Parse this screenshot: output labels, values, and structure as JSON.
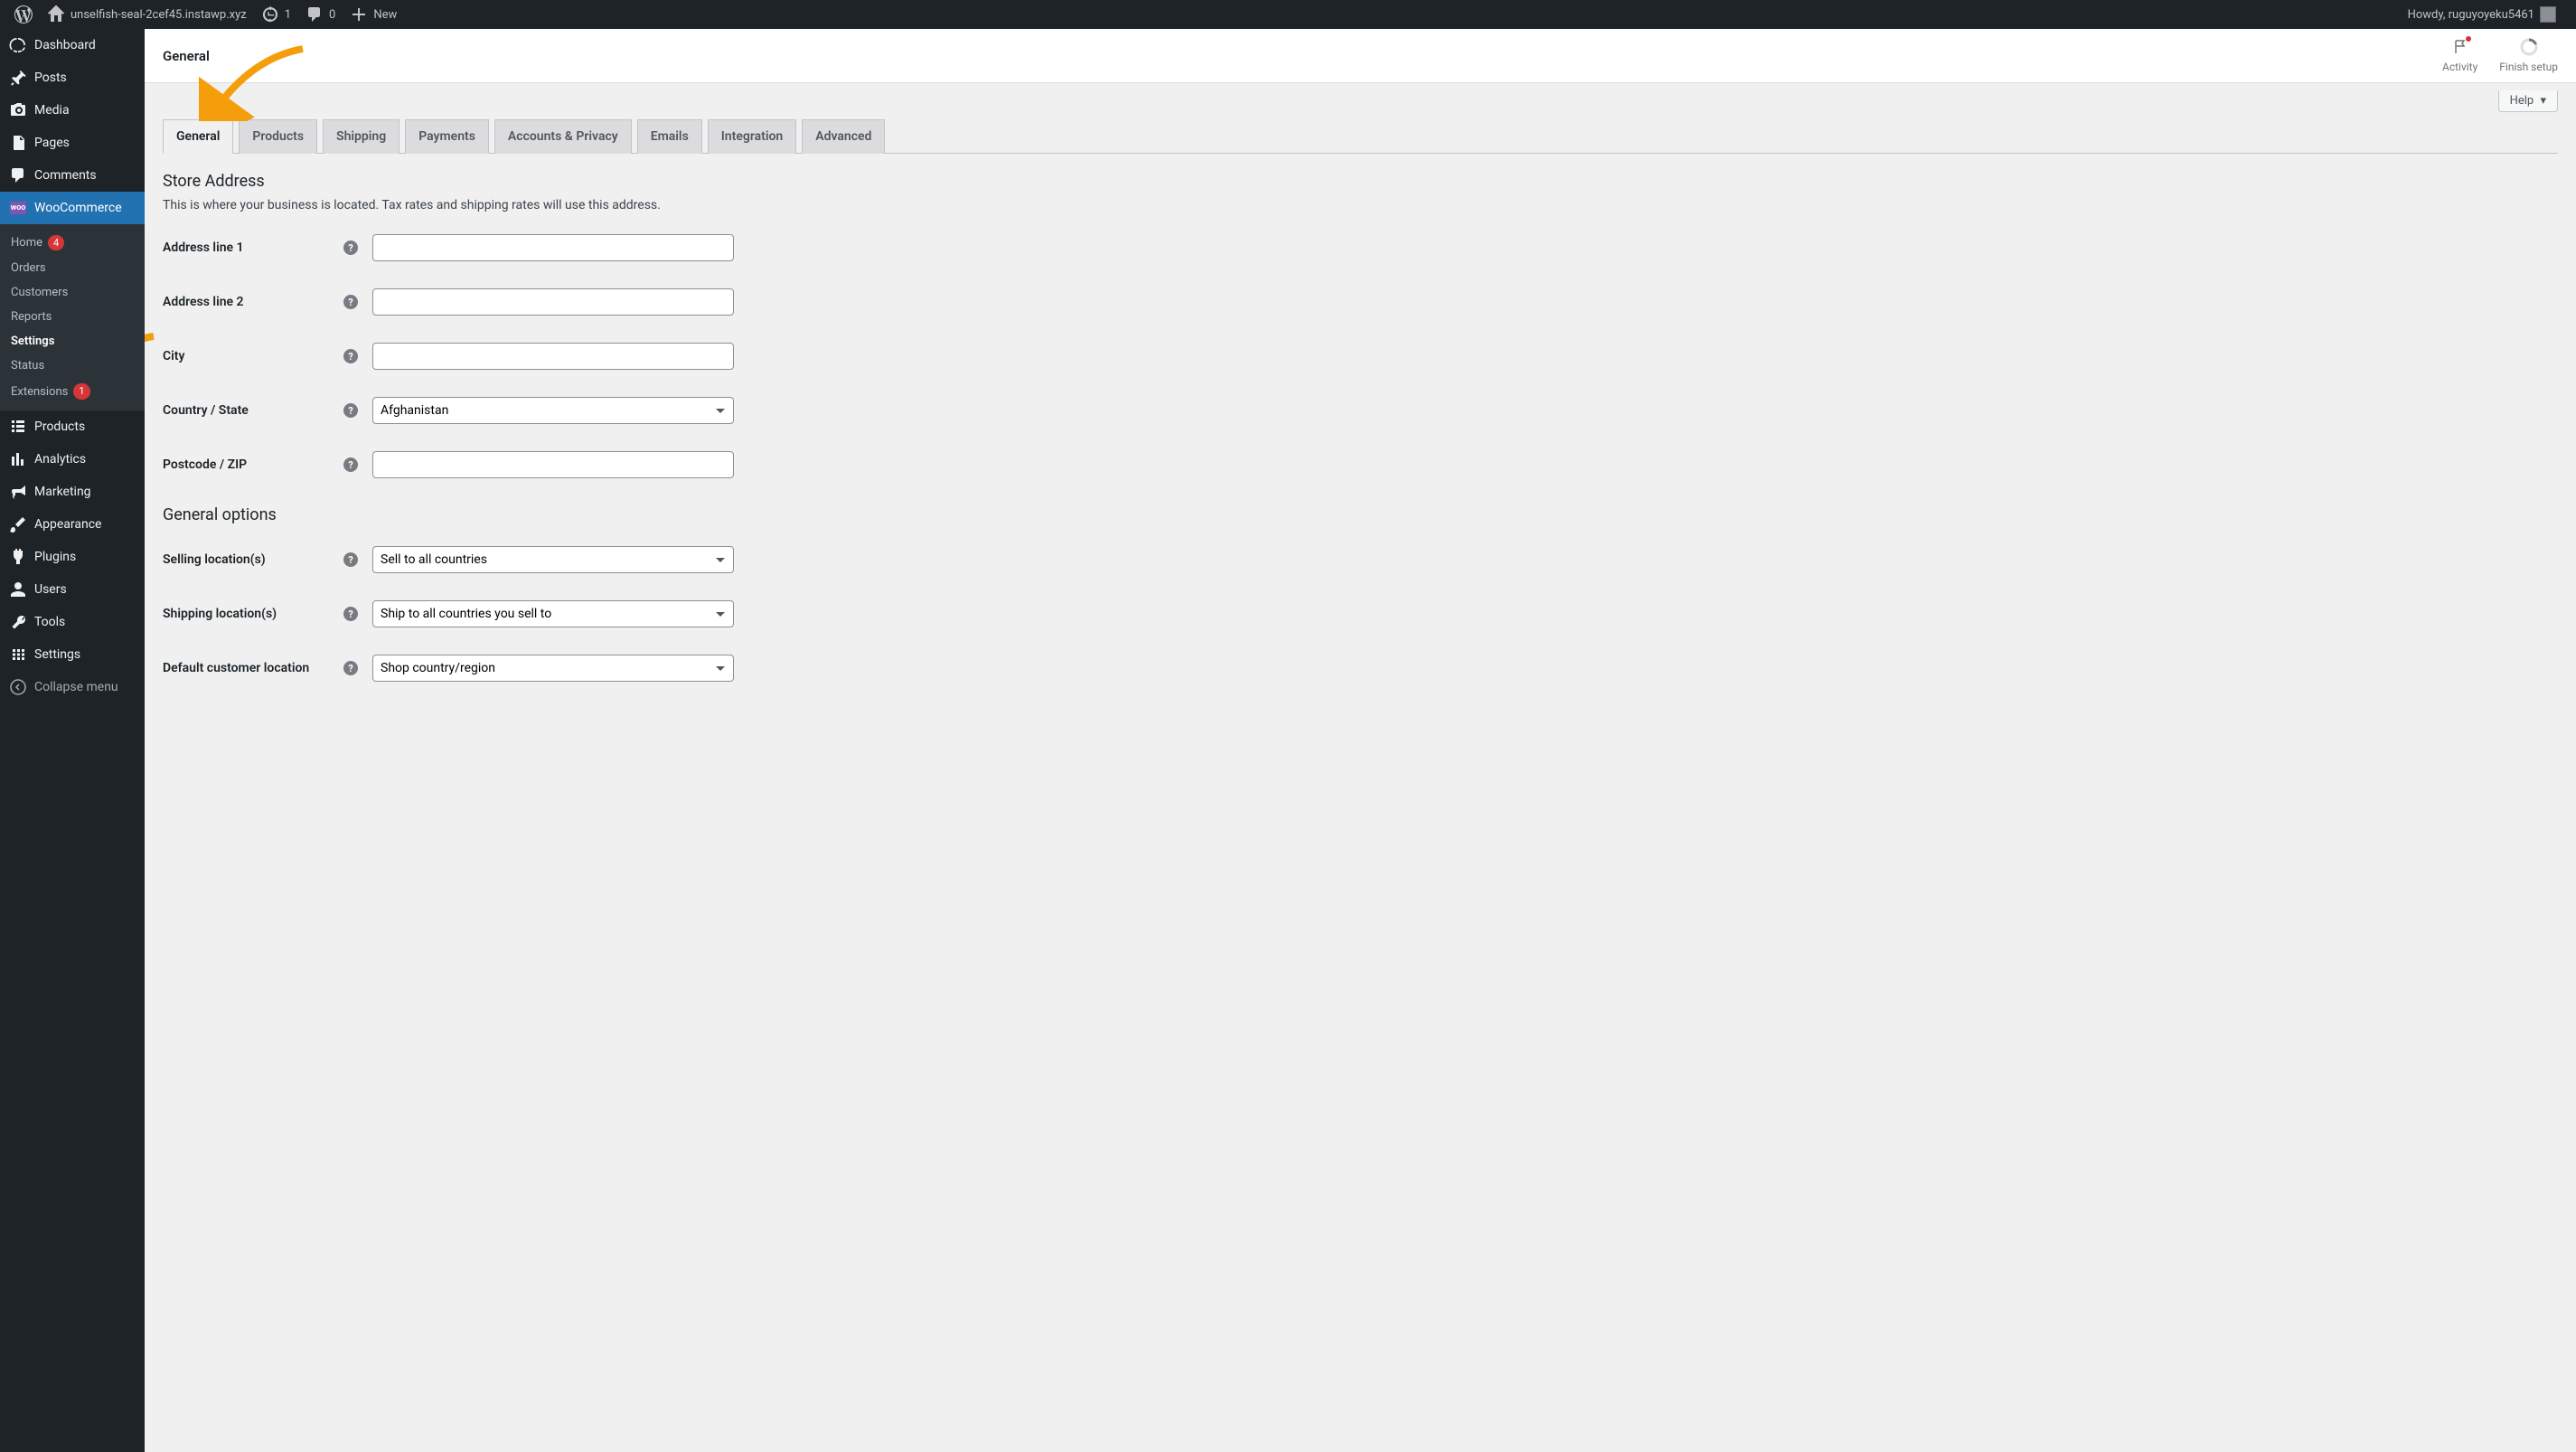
{
  "adminBar": {
    "siteName": "unselfish-seal-2cef45.instawp.xyz",
    "updateCount": "1",
    "commentCount": "0",
    "newLabel": "New",
    "howdy": "Howdy, ruguyoyeku5461"
  },
  "sidebar": {
    "dashboard": "Dashboard",
    "posts": "Posts",
    "media": "Media",
    "pages": "Pages",
    "comments": "Comments",
    "woocommerce": "WooCommerce",
    "wooSubmenu": {
      "home": "Home",
      "homeBadge": "4",
      "orders": "Orders",
      "customers": "Customers",
      "reports": "Reports",
      "settings": "Settings",
      "status": "Status",
      "extensions": "Extensions",
      "extensionsBadge": "1"
    },
    "products": "Products",
    "analytics": "Analytics",
    "marketing": "Marketing",
    "appearance": "Appearance",
    "plugins": "Plugins",
    "users": "Users",
    "tools": "Tools",
    "settingsMain": "Settings",
    "collapse": "Collapse menu"
  },
  "header": {
    "title": "General",
    "activity": "Activity",
    "finishSetup": "Finish setup",
    "help": "Help"
  },
  "tabs": {
    "general": "General",
    "products": "Products",
    "shipping": "Shipping",
    "payments": "Payments",
    "accounts": "Accounts & Privacy",
    "emails": "Emails",
    "integration": "Integration",
    "advanced": "Advanced"
  },
  "form": {
    "storeAddressTitle": "Store Address",
    "storeAddressDesc": "This is where your business is located. Tax rates and shipping rates will use this address.",
    "addressLine1": "Address line 1",
    "addressLine2": "Address line 2",
    "city": "City",
    "countryState": "Country / State",
    "countryValue": "Afghanistan",
    "postcode": "Postcode / ZIP",
    "generalOptionsTitle": "General options",
    "sellingLocations": "Selling location(s)",
    "sellingValue": "Sell to all countries",
    "shippingLocations": "Shipping location(s)",
    "shippingValue": "Ship to all countries you sell to",
    "defaultCustomerLocation": "Default customer location",
    "defaultCustomerValue": "Shop country/region"
  }
}
